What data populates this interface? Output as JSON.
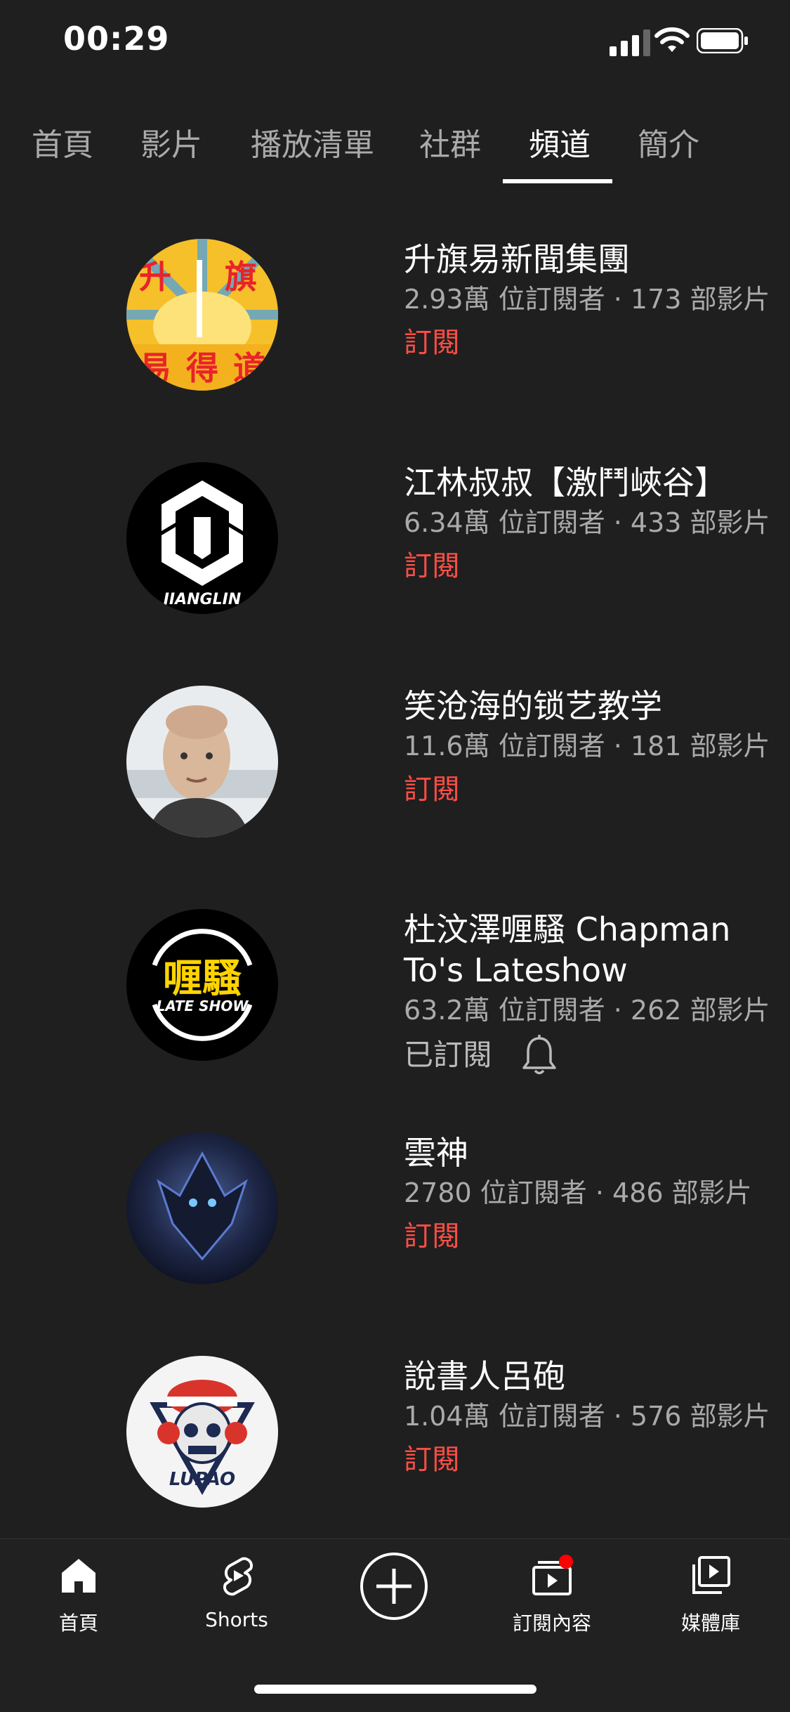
{
  "status_bar": {
    "time": "00:29"
  },
  "tabs": [
    {
      "label": "首頁"
    },
    {
      "label": "影片"
    },
    {
      "label": "播放清單"
    },
    {
      "label": "社群"
    },
    {
      "label": "頻道",
      "active": true
    },
    {
      "label": "簡介"
    }
  ],
  "channels": [
    {
      "name": "升旗易新聞集團",
      "meta": "2.93萬 位訂閱者 · 173 部影片",
      "action": "訂閱",
      "avatar_text": [
        "升",
        "旗",
        "易得道"
      ]
    },
    {
      "name": "江林叔叔【激鬥峽谷】",
      "meta": "6.34萬 位訂閱者 · 433 部影片",
      "action": "訂閱",
      "avatar_text": [
        "JIANGLIN"
      ]
    },
    {
      "name": "笑沧海的锁艺教学",
      "meta": "11.6萬 位訂閱者 · 181 部影片",
      "action": "訂閱"
    },
    {
      "name": "杜汶澤喱騷 Chapman To's Lateshow",
      "meta": "63.2萬 位訂閱者 · 262 部影片",
      "action": "已訂閱",
      "avatar_text": [
        "喱騷",
        "LATE SHOW"
      ]
    },
    {
      "name": "雲神",
      "meta": "2780 位訂閱者 · 486 部影片",
      "action": "訂閱"
    },
    {
      "name": "說書人呂砲",
      "meta": "1.04萬 位訂閱者 · 576 部影片",
      "action": "訂閱",
      "avatar_text": [
        "LUPAO"
      ]
    }
  ],
  "bottom_nav": {
    "home": "首頁",
    "shorts": "Shorts",
    "subscriptions": "訂閱內容",
    "library": "媒體庫"
  },
  "colors": {
    "accent_red": "#ff4e45",
    "background": "#1f1f1f"
  }
}
